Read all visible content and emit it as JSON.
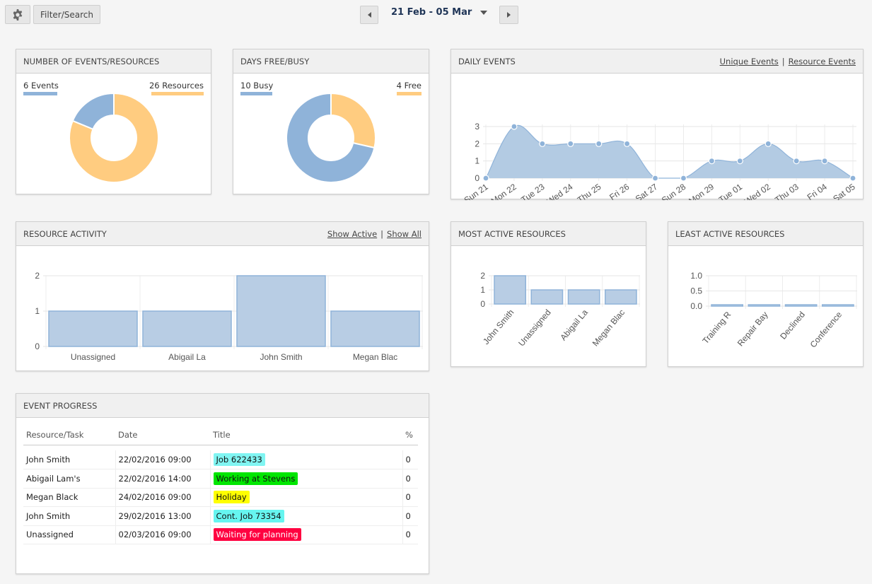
{
  "toolbar": {
    "settings_icon": "gear-icon",
    "filter_label": "Filter/Search",
    "date_range": "21 Feb - 05 Mar",
    "prev_icon": "triangle-left-icon",
    "next_icon": "triangle-right-icon"
  },
  "colors": {
    "blue": "#8fb3d9",
    "orange": "#ffcc80",
    "area_fill": "#b3cbe3",
    "bar_fill": "#b8cde4",
    "bar_stroke": "#8fb3d9"
  },
  "panels": {
    "events_resources": {
      "title": "NUMBER OF EVENTS/RESOURCES",
      "legend_left": "6 Events",
      "legend_right": "26 Resources"
    },
    "days_free_busy": {
      "title": "DAYS FREE/BUSY",
      "legend_left": "10 Busy",
      "legend_right": "4 Free"
    },
    "daily_events": {
      "title": "DAILY EVENTS",
      "link_unique": "Unique Events",
      "link_separator": "|",
      "link_resource": "Resource Events"
    },
    "resource_activity": {
      "title": "RESOURCE ACTIVITY",
      "link_active": "Show Active",
      "link_separator": "|",
      "link_all": "Show All"
    },
    "most_active": {
      "title": "MOST ACTIVE RESOURCES"
    },
    "least_active": {
      "title": "LEAST ACTIVE RESOURCES"
    },
    "event_progress": {
      "title": "EVENT PROGRESS",
      "columns": [
        "Resource/Task",
        "Date",
        "Title",
        "%"
      ],
      "rows": [
        {
          "resource": "John Smith",
          "date": "22/02/2016 09:00",
          "title": "Job 622433",
          "color": "#80f5f2",
          "text_color": "#111",
          "pct": "0"
        },
        {
          "resource": "Abigail Lam's",
          "date": "22/02/2016 14:00",
          "title": "Working at Stevens",
          "color": "#00e600",
          "text_color": "#111",
          "pct": "0"
        },
        {
          "resource": "Megan Black",
          "date": "24/02/2016 09:00",
          "title": "Holiday",
          "color": "#ffff00",
          "text_color": "#111",
          "pct": "0"
        },
        {
          "resource": "John Smith",
          "date": "29/02/2016 13:00",
          "title": "Cont. Job 73354",
          "color": "#66f5f0",
          "text_color": "#111",
          "pct": "0"
        },
        {
          "resource": "Unassigned",
          "date": "02/03/2016 09:00",
          "title": "Waiting for planning",
          "color": "#ff0040",
          "text_color": "#fff",
          "pct": "0"
        }
      ]
    }
  },
  "chart_data": [
    {
      "id": "events_resources",
      "type": "pie",
      "title": "NUMBER OF EVENTS/RESOURCES",
      "donut": true,
      "slices": [
        {
          "label": "Events",
          "value": 6,
          "color": "#8fb3d9"
        },
        {
          "label": "Resources",
          "value": 26,
          "color": "#ffcc80"
        }
      ]
    },
    {
      "id": "days_free_busy",
      "type": "pie",
      "title": "DAYS FREE/BUSY",
      "donut": true,
      "slices": [
        {
          "label": "Free",
          "value": 4,
          "color": "#ffcc80"
        },
        {
          "label": "Busy",
          "value": 10,
          "color": "#8fb3d9"
        }
      ]
    },
    {
      "id": "daily_events",
      "type": "area",
      "title": "DAILY EVENTS",
      "categories": [
        "Sun 21",
        "Mon 22",
        "Tue 23",
        "Wed 24",
        "Thu 25",
        "Fri 26",
        "Sat 27",
        "Sun 28",
        "Mon 29",
        "Tue 01",
        "Wed 02",
        "Thu 03",
        "Fri 04",
        "Sat 05"
      ],
      "values": [
        0,
        3,
        2,
        2,
        2,
        2,
        0,
        0,
        1,
        1,
        2,
        1,
        1,
        0
      ],
      "yticks": [
        0,
        1,
        2,
        3
      ],
      "ylim": [
        0,
        3
      ],
      "grid": true
    },
    {
      "id": "resource_activity",
      "type": "bar",
      "title": "RESOURCE ACTIVITY",
      "categories": [
        "Unassigned",
        "Abigail La",
        "John Smith",
        "Megan Blac"
      ],
      "values": [
        1,
        1,
        2,
        1
      ],
      "yticks": [
        0,
        1,
        2
      ],
      "ylim": [
        0,
        2
      ],
      "grid": true
    },
    {
      "id": "most_active",
      "type": "bar",
      "title": "MOST ACTIVE RESOURCES",
      "categories": [
        "John Smith",
        "Unassigned",
        "Abigail La",
        "Megan Blac"
      ],
      "values": [
        2,
        1,
        1,
        1
      ],
      "yticks": [
        0,
        1,
        2
      ],
      "ylim": [
        0,
        2
      ],
      "grid": true
    },
    {
      "id": "least_active",
      "type": "bar",
      "title": "LEAST ACTIVE RESOURCES",
      "categories": [
        "Training R",
        "Repair Bay",
        "Declined",
        "Conference"
      ],
      "values": [
        0,
        0,
        0,
        0
      ],
      "yticks": [
        "0.0",
        "0.5",
        "1.0"
      ],
      "ylim": [
        0,
        1
      ],
      "grid": true
    }
  ]
}
